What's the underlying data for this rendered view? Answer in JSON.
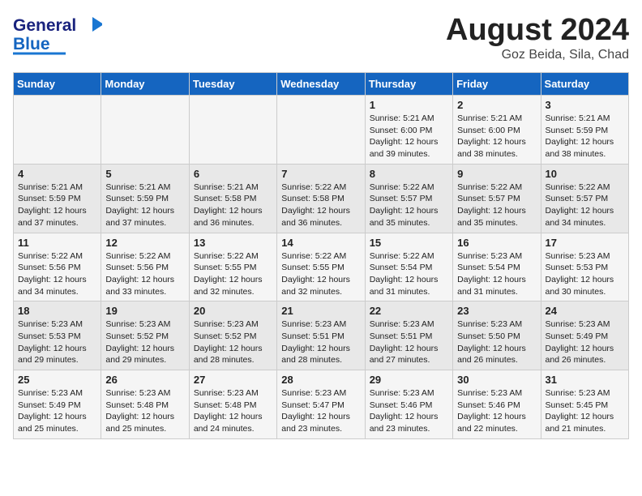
{
  "header": {
    "logo_line1": "General",
    "logo_line2": "Blue",
    "title": "August 2024",
    "subtitle": "Goz Beida, Sila, Chad"
  },
  "weekdays": [
    "Sunday",
    "Monday",
    "Tuesday",
    "Wednesday",
    "Thursday",
    "Friday",
    "Saturday"
  ],
  "weeks": [
    [
      {
        "day": "",
        "info": ""
      },
      {
        "day": "",
        "info": ""
      },
      {
        "day": "",
        "info": ""
      },
      {
        "day": "",
        "info": ""
      },
      {
        "day": "1",
        "info": "Sunrise: 5:21 AM\nSunset: 6:00 PM\nDaylight: 12 hours\nand 39 minutes."
      },
      {
        "day": "2",
        "info": "Sunrise: 5:21 AM\nSunset: 6:00 PM\nDaylight: 12 hours\nand 38 minutes."
      },
      {
        "day": "3",
        "info": "Sunrise: 5:21 AM\nSunset: 5:59 PM\nDaylight: 12 hours\nand 38 minutes."
      }
    ],
    [
      {
        "day": "4",
        "info": "Sunrise: 5:21 AM\nSunset: 5:59 PM\nDaylight: 12 hours\nand 37 minutes."
      },
      {
        "day": "5",
        "info": "Sunrise: 5:21 AM\nSunset: 5:59 PM\nDaylight: 12 hours\nand 37 minutes."
      },
      {
        "day": "6",
        "info": "Sunrise: 5:21 AM\nSunset: 5:58 PM\nDaylight: 12 hours\nand 36 minutes."
      },
      {
        "day": "7",
        "info": "Sunrise: 5:22 AM\nSunset: 5:58 PM\nDaylight: 12 hours\nand 36 minutes."
      },
      {
        "day": "8",
        "info": "Sunrise: 5:22 AM\nSunset: 5:57 PM\nDaylight: 12 hours\nand 35 minutes."
      },
      {
        "day": "9",
        "info": "Sunrise: 5:22 AM\nSunset: 5:57 PM\nDaylight: 12 hours\nand 35 minutes."
      },
      {
        "day": "10",
        "info": "Sunrise: 5:22 AM\nSunset: 5:57 PM\nDaylight: 12 hours\nand 34 minutes."
      }
    ],
    [
      {
        "day": "11",
        "info": "Sunrise: 5:22 AM\nSunset: 5:56 PM\nDaylight: 12 hours\nand 34 minutes."
      },
      {
        "day": "12",
        "info": "Sunrise: 5:22 AM\nSunset: 5:56 PM\nDaylight: 12 hours\nand 33 minutes."
      },
      {
        "day": "13",
        "info": "Sunrise: 5:22 AM\nSunset: 5:55 PM\nDaylight: 12 hours\nand 32 minutes."
      },
      {
        "day": "14",
        "info": "Sunrise: 5:22 AM\nSunset: 5:55 PM\nDaylight: 12 hours\nand 32 minutes."
      },
      {
        "day": "15",
        "info": "Sunrise: 5:22 AM\nSunset: 5:54 PM\nDaylight: 12 hours\nand 31 minutes."
      },
      {
        "day": "16",
        "info": "Sunrise: 5:23 AM\nSunset: 5:54 PM\nDaylight: 12 hours\nand 31 minutes."
      },
      {
        "day": "17",
        "info": "Sunrise: 5:23 AM\nSunset: 5:53 PM\nDaylight: 12 hours\nand 30 minutes."
      }
    ],
    [
      {
        "day": "18",
        "info": "Sunrise: 5:23 AM\nSunset: 5:53 PM\nDaylight: 12 hours\nand 29 minutes."
      },
      {
        "day": "19",
        "info": "Sunrise: 5:23 AM\nSunset: 5:52 PM\nDaylight: 12 hours\nand 29 minutes."
      },
      {
        "day": "20",
        "info": "Sunrise: 5:23 AM\nSunset: 5:52 PM\nDaylight: 12 hours\nand 28 minutes."
      },
      {
        "day": "21",
        "info": "Sunrise: 5:23 AM\nSunset: 5:51 PM\nDaylight: 12 hours\nand 28 minutes."
      },
      {
        "day": "22",
        "info": "Sunrise: 5:23 AM\nSunset: 5:51 PM\nDaylight: 12 hours\nand 27 minutes."
      },
      {
        "day": "23",
        "info": "Sunrise: 5:23 AM\nSunset: 5:50 PM\nDaylight: 12 hours\nand 26 minutes."
      },
      {
        "day": "24",
        "info": "Sunrise: 5:23 AM\nSunset: 5:49 PM\nDaylight: 12 hours\nand 26 minutes."
      }
    ],
    [
      {
        "day": "25",
        "info": "Sunrise: 5:23 AM\nSunset: 5:49 PM\nDaylight: 12 hours\nand 25 minutes."
      },
      {
        "day": "26",
        "info": "Sunrise: 5:23 AM\nSunset: 5:48 PM\nDaylight: 12 hours\nand 25 minutes."
      },
      {
        "day": "27",
        "info": "Sunrise: 5:23 AM\nSunset: 5:48 PM\nDaylight: 12 hours\nand 24 minutes."
      },
      {
        "day": "28",
        "info": "Sunrise: 5:23 AM\nSunset: 5:47 PM\nDaylight: 12 hours\nand 23 minutes."
      },
      {
        "day": "29",
        "info": "Sunrise: 5:23 AM\nSunset: 5:46 PM\nDaylight: 12 hours\nand 23 minutes."
      },
      {
        "day": "30",
        "info": "Sunrise: 5:23 AM\nSunset: 5:46 PM\nDaylight: 12 hours\nand 22 minutes."
      },
      {
        "day": "31",
        "info": "Sunrise: 5:23 AM\nSunset: 5:45 PM\nDaylight: 12 hours\nand 21 minutes."
      }
    ]
  ]
}
